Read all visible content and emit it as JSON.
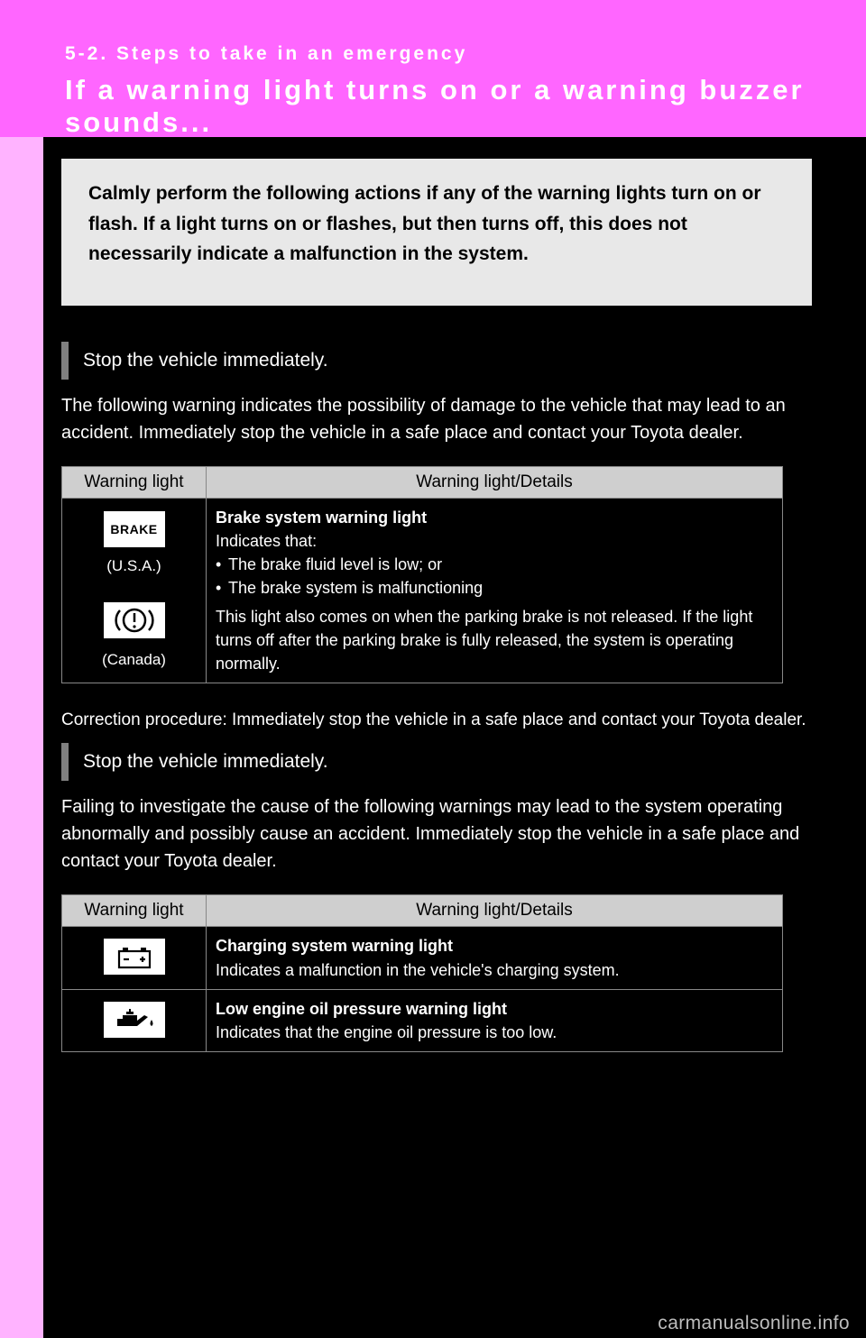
{
  "header": {
    "breadcrumb": "5-2. Steps to take in an emergency",
    "title": "If a warning light turns on or a warning buzzer sounds..."
  },
  "intro": "Calmly perform the following actions if any of the warning lights turn on or flash. If a light turns on or flashes, but then turns off, this does not necessarily indicate a malfunction in the system.",
  "section1": {
    "heading": "Stop the vehicle immediately.",
    "body": "The following warning indicates the possibility of damage to the vehicle that may lead to an accident. Immediately stop the vehicle in a safe place and contact your Toyota dealer.",
    "col1": "Warning light",
    "col2": "Warning light/Details",
    "variant_usa": "(U.S.A.)",
    "variant_canada": "(Canada)",
    "detail_title": "Brake system warning light",
    "detail_sub": "Indicates that:",
    "bullet1": "The brake fluid level is low; or",
    "bullet2": "The brake system is malfunctioning",
    "detail_note": "This light also comes on when the parking brake is not released. If the light turns off after the parking brake is fully released, the system is operating normally.",
    "correction": "Correction procedure: Immediately stop the vehicle in a safe place and contact your Toyota dealer."
  },
  "section2": {
    "heading": "Stop the vehicle immediately.",
    "body": "Failing to investigate the cause of the following warnings may lead to the system operating abnormally and possibly cause an accident. Immediately stop the vehicle in a safe place and contact your Toyota dealer.",
    "col1": "Warning light",
    "col2": "Warning light/Details",
    "row1_title": "Charging system warning light",
    "row1_sub": "Indicates a malfunction in the vehicle's charging system.",
    "row2_title": "Low engine oil pressure warning light",
    "row2_sub": "Indicates that the engine oil pressure is too low."
  },
  "footer": "carmanualsonline.info"
}
